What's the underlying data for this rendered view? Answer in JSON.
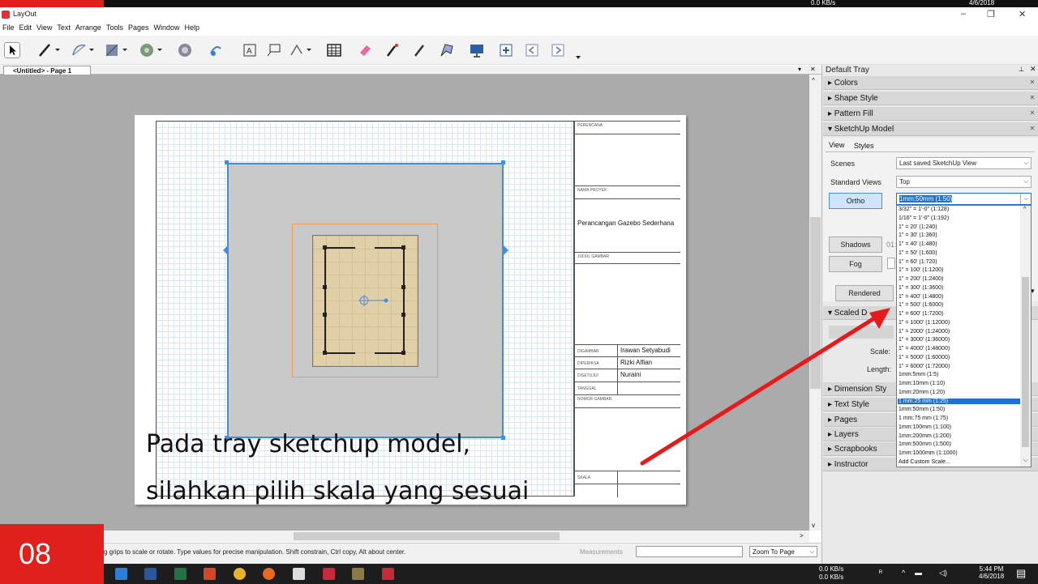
{
  "os": {
    "net_top": "0.0 KB/s",
    "date_top": "4/6/2018"
  },
  "app": {
    "title": "LayOut",
    "minimize": "–",
    "restore": "❐",
    "close": "✕"
  },
  "menu": [
    "File",
    "Edit",
    "View",
    "Text",
    "Arrange",
    "Tools",
    "Pages",
    "Window",
    "Help"
  ],
  "document": {
    "tab_label": "<Untitled> - Page 1"
  },
  "title_block": {
    "perencana": "PERENCANA",
    "nama_proyek": "NAMA PROYEK",
    "project_name": "Perancangan Gazebo Sederhana",
    "judul_gambar": "JUDUL GAMBAR",
    "rows": [
      {
        "label": "DIGAMBAR",
        "value": "Irawan Setyabudi"
      },
      {
        "label": "DIPERIKSA",
        "value": "Rizki Alfian"
      },
      {
        "label": "DISETUJUI",
        "value": "Nuraini"
      },
      {
        "label": "TANGGAL",
        "value": ""
      }
    ],
    "nomor_gambar": "NOMOR GAMBAR",
    "skala": "SKALA"
  },
  "status": {
    "hint": "g grips to scale or rotate. Type values for precise manipulation. Shift constrain, Ctrl copy, Alt about center.",
    "measurements_label": "Measurements",
    "zoom_label": "Zoom To Page"
  },
  "badge": "08",
  "caption": {
    "line1": "Pada tray sketchup model,",
    "line2": "silahkan pilih skala yang sesuai"
  },
  "taskbar": {
    "net_down": "0.0 KB/s",
    "net_up": "0.0 KB/s",
    "time": "5:44 PM",
    "date": "4/6/2018"
  },
  "tray": {
    "title": "Default Tray",
    "panels_top": [
      "▸ Colors",
      "▸ Shape Style",
      "▸ Pattern Fill",
      "▾ SketchUp Model"
    ],
    "tabs": [
      "View",
      "Styles"
    ],
    "scenes_label": "Scenes",
    "scenes_value": "Last saved SketchUp View",
    "std_views_label": "Standard Views",
    "std_views_value": "Top",
    "ortho_label": "Ortho",
    "scale_value": "1mm:50mm (1:50)",
    "shadows_label": "Shadows",
    "shadows_value": "01:",
    "fog_label": "Fog",
    "rendered_label": "Rendered",
    "scaled_header": "▾ Scaled D",
    "scale_label": "Scale:",
    "length_label": "Length:",
    "panels_bottom": [
      "▸ Dimension Sty",
      "▸ Text Style",
      "▸ Pages",
      "▸ Layers",
      "▸ Scrapbooks",
      "▸ Instructor"
    ]
  },
  "scale_options": [
    "3/32\" = 1'-0\" (1:128)",
    "1/16\" = 1'-0\" (1:192)",
    "1\" = 20' (1:240)",
    "1\" = 30' (1:360)",
    "1\" = 40' (1:480)",
    "1\" = 50' (1:600)",
    "1\" = 60' (1:720)",
    "1\" = 100' (1:1200)",
    "1\" = 200' (1:2400)",
    "1\" = 300' (1:3600)",
    "1\" = 400' (1:4800)",
    "1\" = 500' (1:6000)",
    "1\" = 600' (1:7200)",
    "1\" = 1000' (1:12000)",
    "1\" = 2000' (1:24000)",
    "1\" = 3000' (1:36000)",
    "1\" = 4000' (1:48000)",
    "1\" = 5000' (1:60000)",
    "1\" = 6000' (1:72000)",
    "1mm:5mm (1:5)",
    "1mm:10mm (1:10)",
    "1mm:20mm (1:20)",
    "1 mm:25 mm (1:25)",
    "1mm:50mm (1:50)",
    "1 mm:75 mm (1:75)",
    "1mm:100mm (1:100)",
    "1mm:200mm (1:200)",
    "1mm:500mm (1:500)",
    "1mm:1000mm (1:1000)",
    "Add Custom Scale..."
  ],
  "selected_scale_index": 22,
  "colors": {
    "accent": "#3d8fe3",
    "badge_red": "#e0201b",
    "selection": "#1f6fd6",
    "arrow": "#e8191b"
  }
}
